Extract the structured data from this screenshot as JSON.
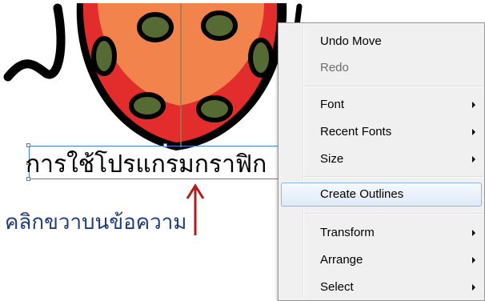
{
  "artboard": {
    "selected_text": "การใช้โปรแกรมกราฟิก",
    "instruction_text": "คลิกขวาบนข้อความ",
    "arrow_color": "#b01e1e",
    "instruction_color": "#1f3b78",
    "ladybug": {
      "shell_color": "#e32d2d",
      "inner_color": "#f2834c",
      "spot_color": "#566b34"
    }
  },
  "context_menu": {
    "items": [
      {
        "label": "Undo Move",
        "disabled": false,
        "submenu": false
      },
      {
        "label": "Redo",
        "disabled": true,
        "submenu": false
      },
      {
        "label": "Font",
        "disabled": false,
        "submenu": true
      },
      {
        "label": "Recent Fonts",
        "disabled": false,
        "submenu": true
      },
      {
        "label": "Size",
        "disabled": false,
        "submenu": true
      },
      {
        "label": "Create Outlines",
        "disabled": false,
        "submenu": false,
        "highlighted": true
      },
      {
        "label": "Transform",
        "disabled": false,
        "submenu": true
      },
      {
        "label": "Arrange",
        "disabled": false,
        "submenu": true
      },
      {
        "label": "Select",
        "disabled": false,
        "submenu": true
      }
    ]
  }
}
